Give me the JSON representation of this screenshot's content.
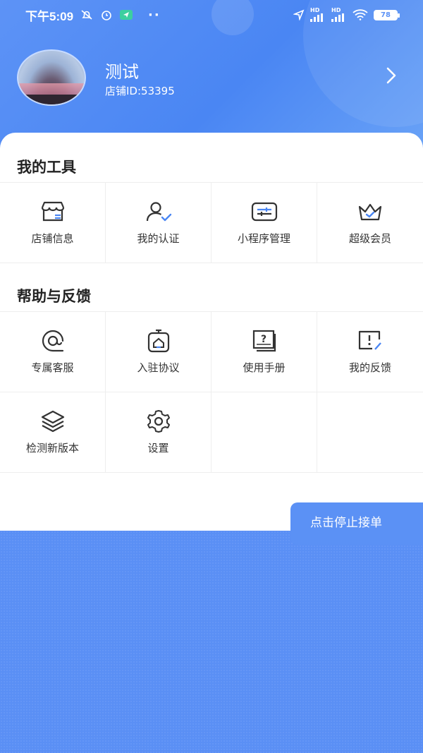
{
  "status_bar": {
    "time": "下午5:09",
    "battery": "78"
  },
  "profile": {
    "name": "测试",
    "shop_id": "店铺ID:53395"
  },
  "tools": {
    "title": "我的工具",
    "items": [
      {
        "label": "店铺信息",
        "icon": "store-icon"
      },
      {
        "label": "我的认证",
        "icon": "user-verified-icon"
      },
      {
        "label": "小程序管理",
        "icon": "mini-program-icon"
      },
      {
        "label": "超级会员",
        "icon": "crown-icon"
      }
    ]
  },
  "help": {
    "title": "帮助与反馈",
    "items": [
      {
        "label": "专属客服",
        "icon": "customer-service-icon"
      },
      {
        "label": "入驻协议",
        "icon": "agreement-icon"
      },
      {
        "label": "使用手册",
        "icon": "manual-icon"
      },
      {
        "label": "我的反馈",
        "icon": "feedback-icon"
      },
      {
        "label": "检测新版本",
        "icon": "layers-icon"
      },
      {
        "label": "设置",
        "icon": "gear-icon"
      }
    ]
  },
  "fab": {
    "label": "点击停止接单"
  },
  "colors": {
    "brand": "#4a86f3",
    "accent": "#5b91f5"
  }
}
